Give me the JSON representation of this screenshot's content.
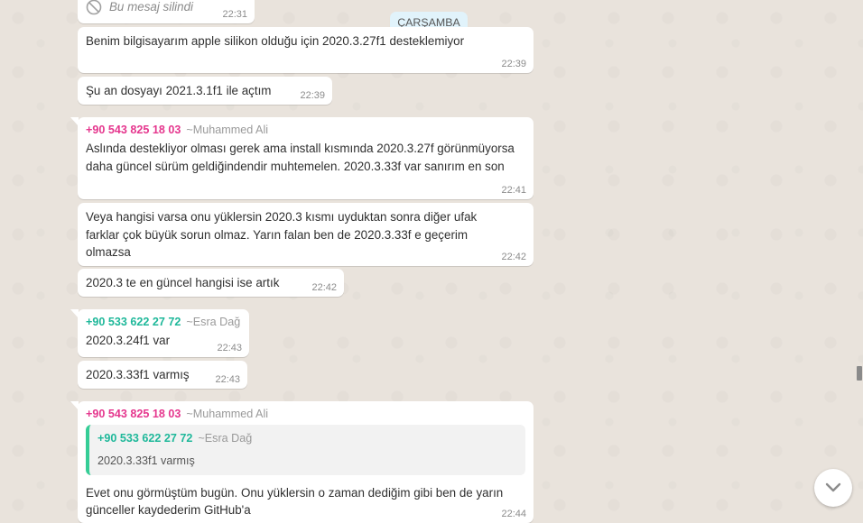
{
  "date_divider": "ÇARŞAMBA",
  "messages": [
    {
      "type": "deleted",
      "text": "Bu mesaj silindi",
      "time": "22:31"
    },
    {
      "text": "Benim bilgisayarım apple silikon olduğu için 2020.3.27f1 desteklemiyor",
      "time": "22:39"
    },
    {
      "text": "Şu an dosyayı 2021.3.1f1 ile açtım",
      "time": "22:39"
    },
    {
      "sender_phone": "+90 543 825 18 03",
      "sender_name": "~Muhammed Ali",
      "text": "Aslında destekliyor olması gerek ama install kısmında 2020.3.27f görünmüyorsa daha güncel sürüm geldiğindendir muhtemelen. 2020.3.33f var sanırım en son",
      "time": "22:41"
    },
    {
      "text": "Veya hangisi varsa onu yüklersin 2020.3 kısmı uyduktan sonra diğer ufak farklar çok büyük sorun olmaz. Yarın falan ben de 2020.3.33f e geçerim olmazsa",
      "time": "22:42"
    },
    {
      "text": "2020.3 te en güncel hangisi ise artık",
      "time": "22:42"
    },
    {
      "sender_phone": "+90 533 622 27 72",
      "sender_name": "~Esra Dağ",
      "text": "2020.3.24f1 var",
      "time": "22:43"
    },
    {
      "text": "2020.3.33f1 varmış",
      "time": "22:43"
    },
    {
      "sender_phone": "+90 543 825 18 03",
      "sender_name": "~Muhammed Ali",
      "quote": {
        "phone": "+90 533 622 27 72",
        "name": "~Esra Dağ",
        "text": "2020.3.33f1 varmış"
      },
      "text": "Evet onu görmüştüm bugün. Onu yüklersin o zaman dediğim gibi ben de yarın günceller kaydederim GitHub'a",
      "time": "22:44"
    }
  ],
  "icons": {
    "deleted": "block-icon",
    "scroll_down": "chevron-down-icon"
  },
  "colors": {
    "sender_muhammed": "#e5378e",
    "sender_esra": "#1fb89a",
    "quote_bar": "#35cd96",
    "date_chip_bg": "#e1f3fb"
  }
}
